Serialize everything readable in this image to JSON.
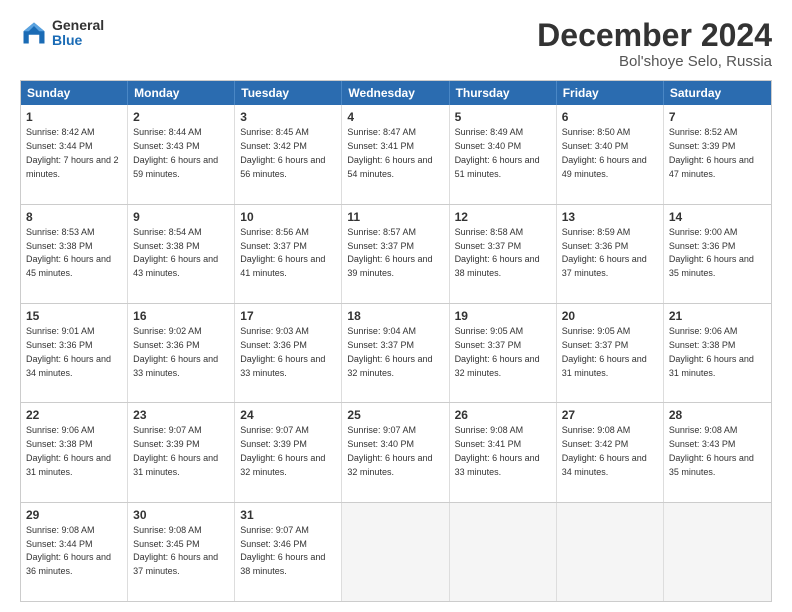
{
  "header": {
    "logo_general": "General",
    "logo_blue": "Blue",
    "month_title": "December 2024",
    "location": "Bol'shoye Selo, Russia"
  },
  "weekdays": [
    "Sunday",
    "Monday",
    "Tuesday",
    "Wednesday",
    "Thursday",
    "Friday",
    "Saturday"
  ],
  "rows": [
    [
      {
        "day": "1",
        "sunrise": "Sunrise: 8:42 AM",
        "sunset": "Sunset: 3:44 PM",
        "daylight": "Daylight: 7 hours and 2 minutes."
      },
      {
        "day": "2",
        "sunrise": "Sunrise: 8:44 AM",
        "sunset": "Sunset: 3:43 PM",
        "daylight": "Daylight: 6 hours and 59 minutes."
      },
      {
        "day": "3",
        "sunrise": "Sunrise: 8:45 AM",
        "sunset": "Sunset: 3:42 PM",
        "daylight": "Daylight: 6 hours and 56 minutes."
      },
      {
        "day": "4",
        "sunrise": "Sunrise: 8:47 AM",
        "sunset": "Sunset: 3:41 PM",
        "daylight": "Daylight: 6 hours and 54 minutes."
      },
      {
        "day": "5",
        "sunrise": "Sunrise: 8:49 AM",
        "sunset": "Sunset: 3:40 PM",
        "daylight": "Daylight: 6 hours and 51 minutes."
      },
      {
        "day": "6",
        "sunrise": "Sunrise: 8:50 AM",
        "sunset": "Sunset: 3:40 PM",
        "daylight": "Daylight: 6 hours and 49 minutes."
      },
      {
        "day": "7",
        "sunrise": "Sunrise: 8:52 AM",
        "sunset": "Sunset: 3:39 PM",
        "daylight": "Daylight: 6 hours and 47 minutes."
      }
    ],
    [
      {
        "day": "8",
        "sunrise": "Sunrise: 8:53 AM",
        "sunset": "Sunset: 3:38 PM",
        "daylight": "Daylight: 6 hours and 45 minutes."
      },
      {
        "day": "9",
        "sunrise": "Sunrise: 8:54 AM",
        "sunset": "Sunset: 3:38 PM",
        "daylight": "Daylight: 6 hours and 43 minutes."
      },
      {
        "day": "10",
        "sunrise": "Sunrise: 8:56 AM",
        "sunset": "Sunset: 3:37 PM",
        "daylight": "Daylight: 6 hours and 41 minutes."
      },
      {
        "day": "11",
        "sunrise": "Sunrise: 8:57 AM",
        "sunset": "Sunset: 3:37 PM",
        "daylight": "Daylight: 6 hours and 39 minutes."
      },
      {
        "day": "12",
        "sunrise": "Sunrise: 8:58 AM",
        "sunset": "Sunset: 3:37 PM",
        "daylight": "Daylight: 6 hours and 38 minutes."
      },
      {
        "day": "13",
        "sunrise": "Sunrise: 8:59 AM",
        "sunset": "Sunset: 3:36 PM",
        "daylight": "Daylight: 6 hours and 37 minutes."
      },
      {
        "day": "14",
        "sunrise": "Sunrise: 9:00 AM",
        "sunset": "Sunset: 3:36 PM",
        "daylight": "Daylight: 6 hours and 35 minutes."
      }
    ],
    [
      {
        "day": "15",
        "sunrise": "Sunrise: 9:01 AM",
        "sunset": "Sunset: 3:36 PM",
        "daylight": "Daylight: 6 hours and 34 minutes."
      },
      {
        "day": "16",
        "sunrise": "Sunrise: 9:02 AM",
        "sunset": "Sunset: 3:36 PM",
        "daylight": "Daylight: 6 hours and 33 minutes."
      },
      {
        "day": "17",
        "sunrise": "Sunrise: 9:03 AM",
        "sunset": "Sunset: 3:36 PM",
        "daylight": "Daylight: 6 hours and 33 minutes."
      },
      {
        "day": "18",
        "sunrise": "Sunrise: 9:04 AM",
        "sunset": "Sunset: 3:37 PM",
        "daylight": "Daylight: 6 hours and 32 minutes."
      },
      {
        "day": "19",
        "sunrise": "Sunrise: 9:05 AM",
        "sunset": "Sunset: 3:37 PM",
        "daylight": "Daylight: 6 hours and 32 minutes."
      },
      {
        "day": "20",
        "sunrise": "Sunrise: 9:05 AM",
        "sunset": "Sunset: 3:37 PM",
        "daylight": "Daylight: 6 hours and 31 minutes."
      },
      {
        "day": "21",
        "sunrise": "Sunrise: 9:06 AM",
        "sunset": "Sunset: 3:38 PM",
        "daylight": "Daylight: 6 hours and 31 minutes."
      }
    ],
    [
      {
        "day": "22",
        "sunrise": "Sunrise: 9:06 AM",
        "sunset": "Sunset: 3:38 PM",
        "daylight": "Daylight: 6 hours and 31 minutes."
      },
      {
        "day": "23",
        "sunrise": "Sunrise: 9:07 AM",
        "sunset": "Sunset: 3:39 PM",
        "daylight": "Daylight: 6 hours and 31 minutes."
      },
      {
        "day": "24",
        "sunrise": "Sunrise: 9:07 AM",
        "sunset": "Sunset: 3:39 PM",
        "daylight": "Daylight: 6 hours and 32 minutes."
      },
      {
        "day": "25",
        "sunrise": "Sunrise: 9:07 AM",
        "sunset": "Sunset: 3:40 PM",
        "daylight": "Daylight: 6 hours and 32 minutes."
      },
      {
        "day": "26",
        "sunrise": "Sunrise: 9:08 AM",
        "sunset": "Sunset: 3:41 PM",
        "daylight": "Daylight: 6 hours and 33 minutes."
      },
      {
        "day": "27",
        "sunrise": "Sunrise: 9:08 AM",
        "sunset": "Sunset: 3:42 PM",
        "daylight": "Daylight: 6 hours and 34 minutes."
      },
      {
        "day": "28",
        "sunrise": "Sunrise: 9:08 AM",
        "sunset": "Sunset: 3:43 PM",
        "daylight": "Daylight: 6 hours and 35 minutes."
      }
    ],
    [
      {
        "day": "29",
        "sunrise": "Sunrise: 9:08 AM",
        "sunset": "Sunset: 3:44 PM",
        "daylight": "Daylight: 6 hours and 36 minutes."
      },
      {
        "day": "30",
        "sunrise": "Sunrise: 9:08 AM",
        "sunset": "Sunset: 3:45 PM",
        "daylight": "Daylight: 6 hours and 37 minutes."
      },
      {
        "day": "31",
        "sunrise": "Sunrise: 9:07 AM",
        "sunset": "Sunset: 3:46 PM",
        "daylight": "Daylight: 6 hours and 38 minutes."
      },
      {
        "day": "",
        "sunrise": "",
        "sunset": "",
        "daylight": ""
      },
      {
        "day": "",
        "sunrise": "",
        "sunset": "",
        "daylight": ""
      },
      {
        "day": "",
        "sunrise": "",
        "sunset": "",
        "daylight": ""
      },
      {
        "day": "",
        "sunrise": "",
        "sunset": "",
        "daylight": ""
      }
    ]
  ]
}
